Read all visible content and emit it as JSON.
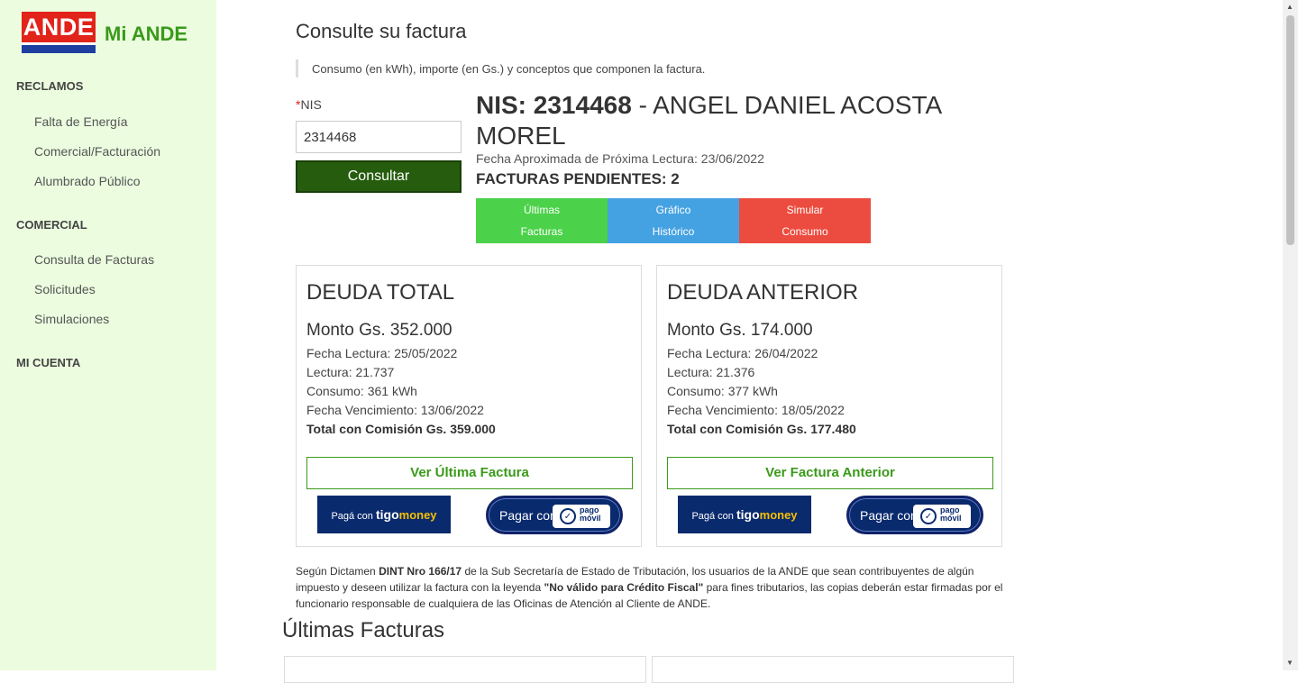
{
  "sidebar": {
    "logo_text": "ANDE",
    "app_name": "Mi ANDE",
    "sections": [
      {
        "label": "RECLAMOS",
        "items": [
          "Falta de Energía",
          "Comercial/Facturación",
          "Alumbrado Público"
        ]
      },
      {
        "label": "COMERCIAL",
        "items": [
          "Consulta de Facturas",
          "Solicitudes",
          "Simulaciones"
        ]
      },
      {
        "label": "MI CUENTA",
        "items": []
      }
    ]
  },
  "main": {
    "title": "Consulte su factura",
    "subtitle": "Consumo (en kWh), importe (en Gs.) y conceptos que componen la factura.",
    "nis_label": "NIS",
    "nis_required_mark": "*",
    "nis_value": "2314468",
    "consultar_label": "Consultar",
    "nis_title_prefix": "NIS: 2314468",
    "nis_title_name": " - ANGEL DANIEL ACOSTA MOREL",
    "fecha_proxima": "Fecha Aproximada de Próxima Lectura: 23/06/2022",
    "pendientes": "FACTURAS PENDIENTES: 2",
    "tabs": [
      {
        "line1": "Últimas",
        "line2": "Facturas",
        "color": "#4cd14b"
      },
      {
        "line1": "Gráfico",
        "line2": "Histórico",
        "color": "#45a2e2"
      },
      {
        "line1": "Simular",
        "line2": "Consumo",
        "color": "#ec4c3f"
      }
    ]
  },
  "cards": [
    {
      "title": "DEUDA TOTAL",
      "monto": "Monto Gs. 352.000",
      "fecha_lectura": "Fecha Lectura: 25/05/2022",
      "lectura": "Lectura: 21.737",
      "consumo": "Consumo: 361 kWh",
      "vencimiento": "Fecha Vencimiento: 13/06/2022",
      "total": "Total con Comisión Gs. 359.000",
      "button": "Ver Última Factura",
      "tigo_prefix": "Pagá con",
      "tigo_brand": "tigo",
      "tigo_money": "money",
      "pago_label": "Pagar con",
      "pago_brand_1": "pago",
      "pago_brand_2": "móvil"
    },
    {
      "title": "DEUDA ANTERIOR",
      "monto": "Monto Gs. 174.000",
      "fecha_lectura": "Fecha Lectura: 26/04/2022",
      "lectura": "Lectura: 21.376",
      "consumo": "Consumo: 377 kWh",
      "vencimiento": "Fecha Vencimiento: 18/05/2022",
      "total": "Total con Comisión Gs. 177.480",
      "button": "Ver Factura Anterior",
      "tigo_prefix": "Pagá con",
      "tigo_brand": "tigo",
      "tigo_money": "money",
      "pago_label": "Pagar con",
      "pago_brand_1": "pago",
      "pago_brand_2": "móvil"
    }
  ],
  "dictamen": {
    "t1": "Según Dictamen ",
    "b1": "DINT Nro 166/17",
    "t2": " de la Sub Secretaría de Estado de Tributación, los usuarios de la ANDE que sean contribuyentes de algún impuesto y deseen utilizar la factura con la leyenda ",
    "b2": "\"No válido para Crédito Fiscal\"",
    "t3": " para fines tributarios, las copias deberán estar firmadas por el funcionario responsable de cualquiera de las Oficinas de Atención al Cliente de ANDE."
  },
  "ultimas_title": "Últimas Facturas",
  "colors": {
    "sidebar_bg": "#ebfcdf",
    "brand_green": "#3a9a1a",
    "consultar_bg": "#265c0e",
    "logo_red": "#e2231a",
    "logo_blue": "#1f3fa0"
  }
}
